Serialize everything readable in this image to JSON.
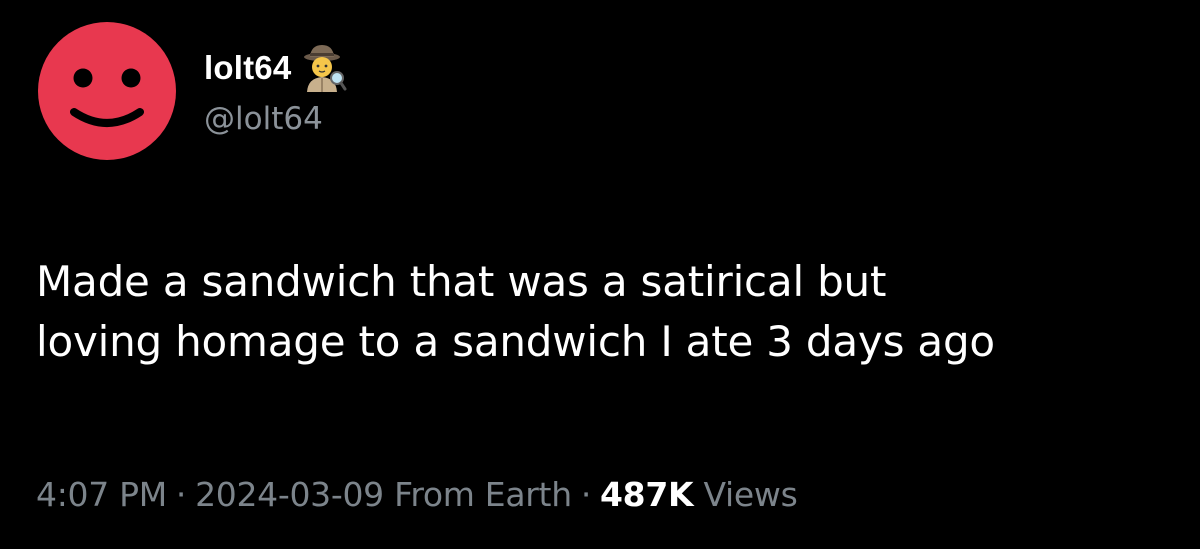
{
  "tweet": {
    "author": {
      "display_name": "lolt64",
      "handle": "@lolt64",
      "avatar_icon": "smiley-face-icon",
      "avatar_color": "#e8384f",
      "badge_icon": "detective-emoji-icon"
    },
    "text_lines": [
      "Made a sandwich that was a satirical but",
      "loving homage to a sandwich I ate 3 days ago"
    ],
    "meta": {
      "time": "4:07 PM",
      "separator": "·",
      "date": "2024-03-09",
      "source": "From Earth",
      "views_count": "487K",
      "views_label": "Views"
    }
  }
}
